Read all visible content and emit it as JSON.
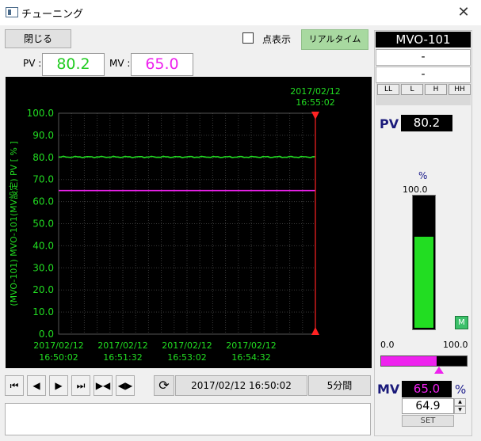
{
  "window": {
    "title": "チューニング",
    "close_glyph": "✕"
  },
  "toolbar": {
    "close_label": "閉じる",
    "show_points_label": "点表示",
    "show_points_checked": false,
    "realtime_label": "リアルタイム"
  },
  "readouts": {
    "pv_label": "PV :",
    "pv_value": "80.2",
    "mv_label": "MV :",
    "mv_value": "65.0"
  },
  "colors": {
    "pv": "#22dd22",
    "mv": "#ee22ee",
    "axis_text": "#22dd22",
    "cursor": "#ff2222",
    "chart_bg": "#000000"
  },
  "chart_data": {
    "type": "line",
    "ylabel": "(MVO-101) MVO-101(MV設定) PV [ % ]",
    "ylim": [
      0,
      100
    ],
    "y_ticks": [
      "0.0",
      "10.0",
      "20.0",
      "30.0",
      "40.0",
      "50.0",
      "60.0",
      "70.0",
      "80.0",
      "90.0",
      "100.0"
    ],
    "x_ticks": [
      {
        "date": "2017/02/12",
        "time": "16:50:02"
      },
      {
        "date": "2017/02/12",
        "time": "16:51:32"
      },
      {
        "date": "2017/02/12",
        "time": "16:53:02"
      },
      {
        "date": "2017/02/12",
        "time": "16:54:32"
      }
    ],
    "cursor": {
      "date": "2017/02/12",
      "time": "16:55:02"
    },
    "grid": true,
    "series": [
      {
        "name": "PV",
        "value": 80.2,
        "x_start": "16:50:02",
        "x_end": "16:55:02"
      },
      {
        "name": "MV",
        "value": 65.0,
        "x_start": "16:50:02",
        "x_end": "16:55:02"
      }
    ]
  },
  "nav": {
    "buttons": [
      {
        "name": "fast-rewind-button",
        "glyph": "⏮"
      },
      {
        "name": "step-back-button",
        "glyph": "◀"
      },
      {
        "name": "step-forward-button",
        "glyph": "▶"
      },
      {
        "name": "fast-forward-button",
        "glyph": "⏭"
      },
      {
        "name": "zoom-in-button",
        "glyph": "▶◀"
      },
      {
        "name": "zoom-out-button",
        "glyph": "◀▶"
      }
    ],
    "refresh_glyph": "⟳",
    "time_value": "2017/02/12 16:50:02",
    "range_label": "5分間"
  },
  "panel": {
    "tag": "MVO-101",
    "line1": "-",
    "line2": "-",
    "alarms": [
      "LL",
      "L",
      "H",
      "HH"
    ],
    "pv_label": "PV",
    "pv_value": "80.2",
    "bar_unit": "%",
    "bar_max": "100.0",
    "bar_level_pct": 80.2,
    "mode_label": "M",
    "mv_min": "0.0",
    "mv_max": "100.0",
    "mv_level_pct": 65.0,
    "mv_label": "MV",
    "mv_value": "65.0",
    "mv_unit": "%",
    "set_value": "64.9",
    "set_label": "SET"
  }
}
